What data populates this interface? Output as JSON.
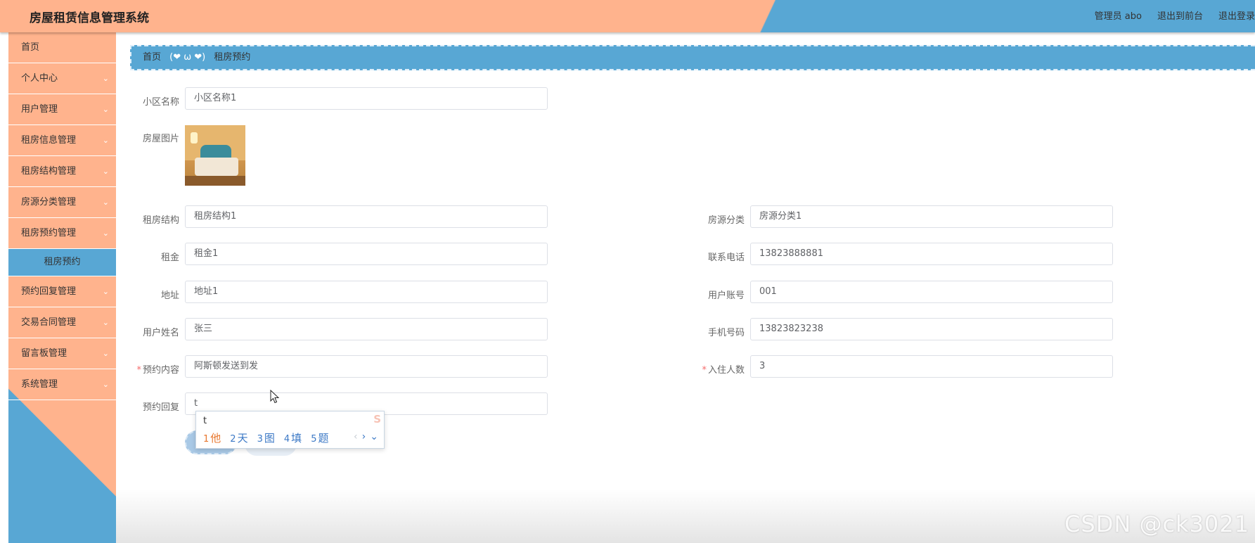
{
  "header": {
    "title": "房屋租赁信息管理系统",
    "user": "管理员 abo",
    "front_link": "退出到前台",
    "logout_link": "退出登录"
  },
  "sidebar": {
    "items": [
      {
        "label": "首页",
        "has_children": false
      },
      {
        "label": "个人中心",
        "has_children": true
      },
      {
        "label": "用户管理",
        "has_children": true
      },
      {
        "label": "租房信息管理",
        "has_children": true
      },
      {
        "label": "租房结构管理",
        "has_children": true
      },
      {
        "label": "房源分类管理",
        "has_children": true
      },
      {
        "label": "租房预约管理",
        "has_children": true
      }
    ],
    "active_sub": "租房预约",
    "items_after": [
      {
        "label": "预约回复管理"
      },
      {
        "label": "交易合同管理"
      },
      {
        "label": "留言板管理"
      },
      {
        "label": "系统管理"
      }
    ],
    "chevron": "⌄"
  },
  "breadcrumb": {
    "home": "首页",
    "separator": "(❤ ω ❤)",
    "current": "租房预约"
  },
  "form": {
    "community_label": "小区名称",
    "community_value": "小区名称1",
    "photo_label": "房屋图片",
    "structure_label": "租房结构",
    "structure_value": "租房结构1",
    "category_label": "房源分类",
    "category_value": "房源分类1",
    "rent_label": "租金",
    "rent_value": "租金1",
    "phone_label": "联系电话",
    "phone_value": "13823888881",
    "address_label": "地址",
    "address_value": "地址1",
    "account_label": "用户账号",
    "account_value": "001",
    "username_label": "用户姓名",
    "username_value": "张三",
    "mobile_label": "手机号码",
    "mobile_value": "13823823238",
    "required_mark": "*",
    "booking_label": "预约内容",
    "booking_value": "阿斯顿发送到发",
    "occupants_label": "入住人数",
    "occupants_value": "3",
    "reply_label": "预约回复",
    "reply_value": "t"
  },
  "ime": {
    "composition": "t",
    "candidates": [
      {
        "num": "1",
        "text": "他"
      },
      {
        "num": "2",
        "text": "天"
      },
      {
        "num": "3",
        "text": "图"
      },
      {
        "num": "4",
        "text": "填"
      },
      {
        "num": "5",
        "text": "题"
      }
    ],
    "prev": "‹",
    "next": "›",
    "expand": "⌄",
    "logo": "S"
  },
  "watermark": "CSDN @ck3021",
  "colors": {
    "accent_orange": "#ffb38d",
    "accent_blue": "#58a7d4"
  }
}
